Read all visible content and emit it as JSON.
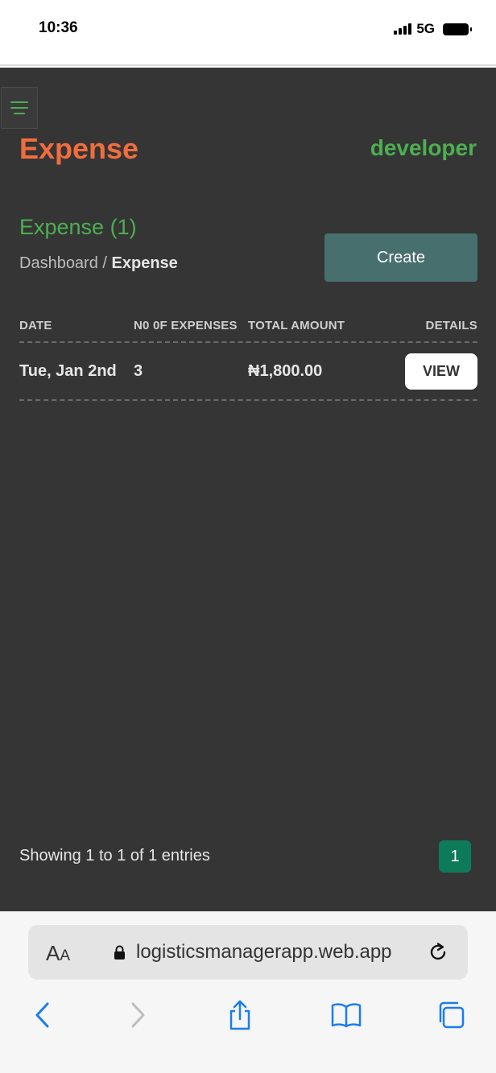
{
  "status_bar": {
    "time": "10:36",
    "network": "5G"
  },
  "header": {
    "title": "Expense",
    "username": "developer"
  },
  "section": {
    "title": "Expense (1)",
    "breadcrumb_root": "Dashboard",
    "breadcrumb_sep": "/",
    "breadcrumb_current": "Expense",
    "create_label": "Create"
  },
  "table": {
    "columns": [
      "DATE",
      "N0 0F EXPENSES",
      "TOTAL AMOUNT",
      "DETAILS"
    ],
    "rows": [
      {
        "date": "Tue, Jan 2nd",
        "count": "3",
        "amount": "₦1,800.00",
        "action": "VIEW"
      }
    ]
  },
  "footer": {
    "showing": "Showing 1 to 1 of 1 entries",
    "page": "1"
  },
  "browser": {
    "aa_big": "A",
    "aa_small": "A",
    "url": "logisticsmanagerapp.web.app"
  },
  "colors": {
    "title": "#f26d3d",
    "accent_green": "#4caf50",
    "create_button": "#476f6d",
    "page_button": "#0d7a5a",
    "background": "#353535",
    "browser_blue": "#1a7cf5"
  },
  "icons": [
    "menu-icon",
    "signal-icon",
    "battery-icon",
    "lock-icon",
    "reload-icon",
    "back-icon",
    "forward-icon",
    "share-icon",
    "bookmarks-icon",
    "tabs-icon"
  ]
}
